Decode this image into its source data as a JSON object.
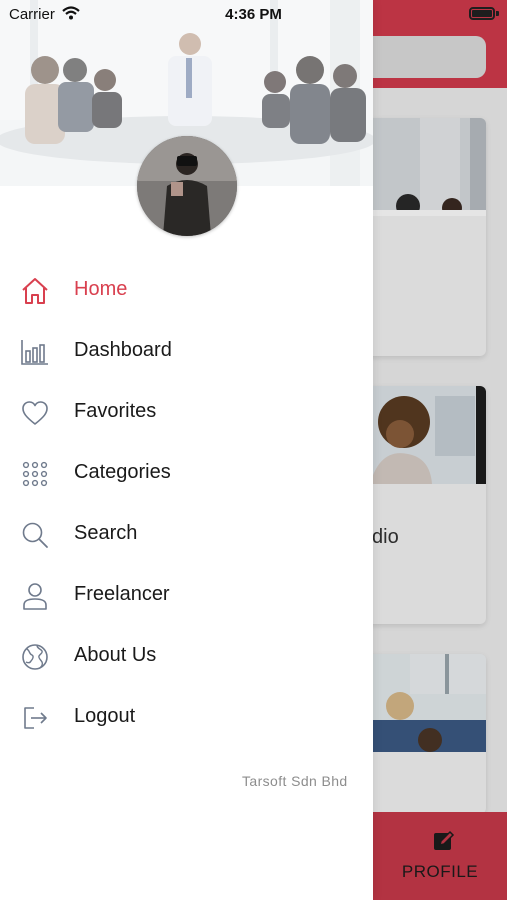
{
  "status_bar": {
    "carrier": "Carrier",
    "time": "4:36 PM"
  },
  "drawer": {
    "menu": [
      {
        "label": "Home",
        "icon": "home-icon",
        "active": true
      },
      {
        "label": "Dashboard",
        "icon": "bar-chart-icon",
        "active": false
      },
      {
        "label": "Favorites",
        "icon": "heart-icon",
        "active": false
      },
      {
        "label": "Categories",
        "icon": "grid-dots-icon",
        "active": false
      },
      {
        "label": "Search",
        "icon": "search-icon",
        "active": false
      },
      {
        "label": "Freelancer",
        "icon": "user-icon",
        "active": false
      },
      {
        "label": "About Us",
        "icon": "globe-icon",
        "active": false
      },
      {
        "label": "Logout",
        "icon": "logout-icon",
        "active": false
      }
    ],
    "footer": "Tarsoft Sdn Bhd"
  },
  "background_app": {
    "card_partial_text": "dio",
    "bottom_bar_label": "PROFILE"
  },
  "colors": {
    "accent": "#d9404f",
    "header_red": "#d23a4c",
    "icon_gray": "#6f7a8c"
  }
}
